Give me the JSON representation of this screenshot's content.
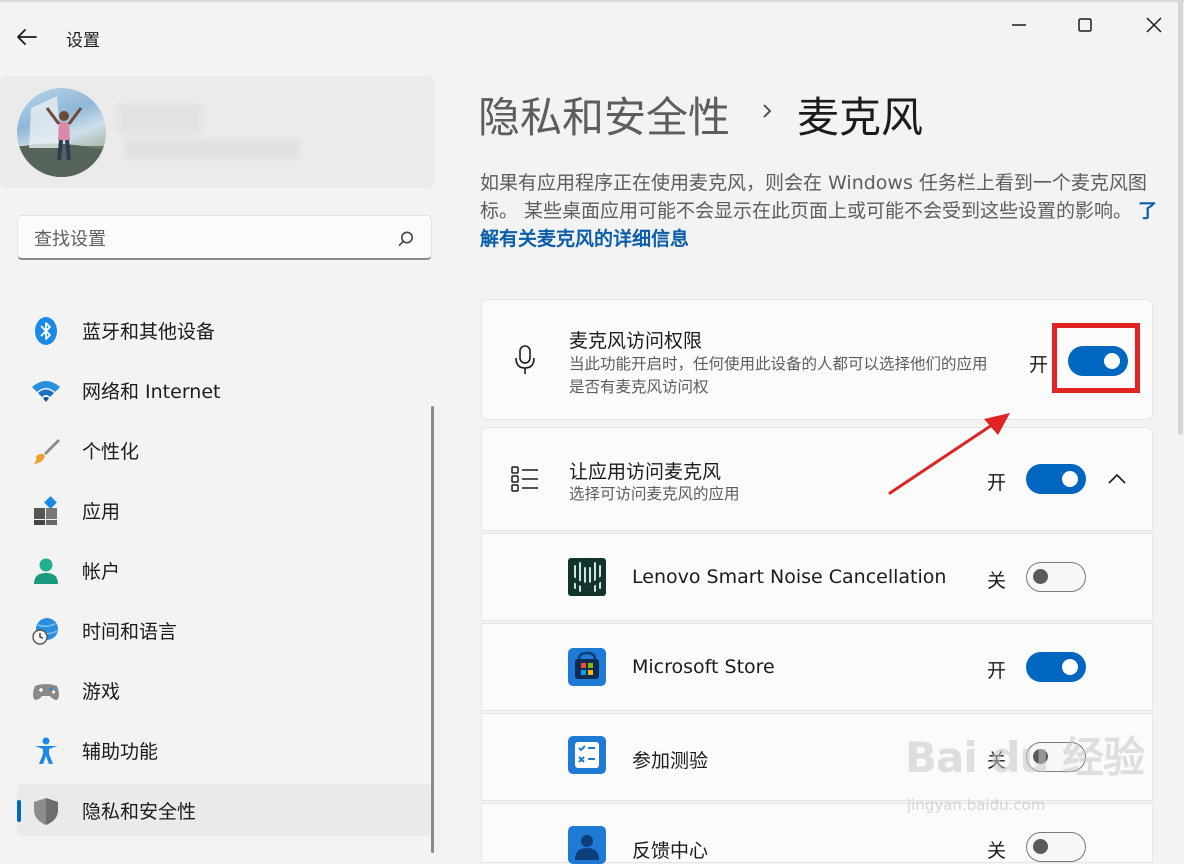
{
  "window": {
    "app_title": "设置",
    "controls": [
      "minimize",
      "maximize",
      "close"
    ]
  },
  "search": {
    "placeholder": "查找设置"
  },
  "sidebar": {
    "items": [
      {
        "label": "蓝牙和其他设备",
        "icon": "bluetooth-icon"
      },
      {
        "label": "网络和 Internet",
        "icon": "wifi-icon"
      },
      {
        "label": "个性化",
        "icon": "paintbrush-icon"
      },
      {
        "label": "应用",
        "icon": "apps-icon"
      },
      {
        "label": "帐户",
        "icon": "account-icon"
      },
      {
        "label": "时间和语言",
        "icon": "globe-clock-icon"
      },
      {
        "label": "游戏",
        "icon": "gamepad-icon"
      },
      {
        "label": "辅助功能",
        "icon": "accessibility-icon"
      },
      {
        "label": "隐私和安全性",
        "icon": "shield-icon",
        "selected": true
      }
    ]
  },
  "header": {
    "parent": "隐私和安全性",
    "current": "麦克风"
  },
  "description": {
    "text": "如果有应用程序正在使用麦克风，则会在 Windows 任务栏上看到一个麦克风图标。 某些桌面应用可能不会显示在此页面上或可能不会受到这些设置的影响。 ",
    "link": "了解有关麦克风的详细信息"
  },
  "mic_access": {
    "title": "麦克风访问权限",
    "subtitle": "当此功能开启时，任何使用此设备的人都可以选择他们的应用是否有麦克风访问权",
    "state": "开",
    "on": true
  },
  "app_access": {
    "title": "让应用访问麦克风",
    "subtitle": "选择可访问麦克风的应用",
    "state": "开",
    "on": true
  },
  "apps": [
    {
      "name": "Lenovo Smart Noise Cancellation",
      "state": "关",
      "on": false,
      "icon": "lenovo-noise-icon"
    },
    {
      "name": "Microsoft Store",
      "state": "开",
      "on": true,
      "icon": "store-icon"
    },
    {
      "name": "参加测验",
      "state": "关",
      "on": false,
      "icon": "quiz-icon"
    },
    {
      "name": "反馈中心",
      "state": "关",
      "on": false,
      "icon": "feedback-icon"
    }
  ],
  "watermark": {
    "main": "Bai du 经验",
    "sub": "jingyan.baidu.com"
  },
  "colors": {
    "accent": "#0067c0",
    "highlight": "#e02323",
    "link": "#0a5da8"
  }
}
